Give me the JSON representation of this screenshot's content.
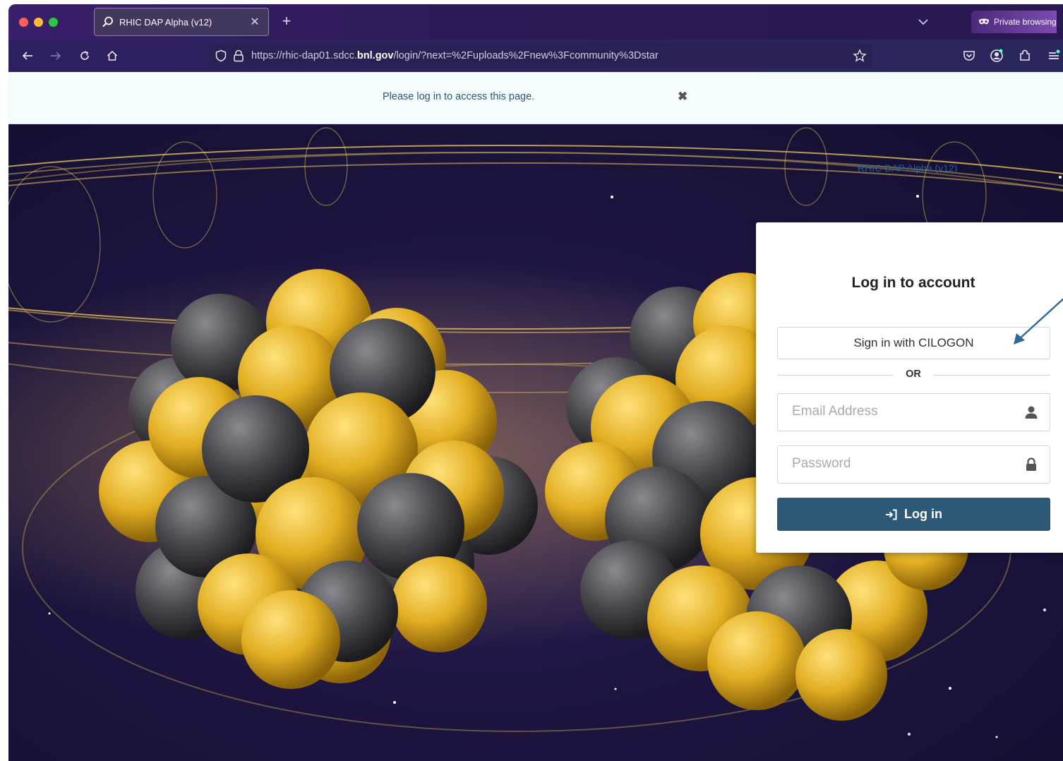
{
  "browser": {
    "tab": {
      "title": "RHIC DAP Alpha (v12)",
      "close_glyph": "✕"
    },
    "new_tab_glyph": "+",
    "private_label": "Private browsing",
    "url": {
      "prefix": "https://rhic-dap01.sdcc.",
      "domain": "bnl.gov",
      "path": "/login/?next=%2Fuploads%2Fnew%3Fcommunity%3Dstar"
    },
    "icons": [
      "back-icon",
      "forward-icon",
      "reload-icon",
      "home-icon",
      "shield-icon",
      "lock-icon",
      "star-icon",
      "pocket-icon",
      "account-icon",
      "extensions-icon",
      "menu-icon"
    ]
  },
  "flash": {
    "message": "Please log in to access this page.",
    "close_glyph": "✖"
  },
  "hero": {
    "watermark": "RHIC DAP Alpha (v12)"
  },
  "login": {
    "title": "Log in to account",
    "cilogon_label": "Sign in with CILOGON",
    "or_label": "OR",
    "email_placeholder": "Email Address",
    "password_placeholder": "Password",
    "submit_label": "Log in"
  },
  "colors": {
    "primary_button": "#2e5a78",
    "flash_text": "#2d5a6f",
    "nucleon_gold": "#e8b62a",
    "nucleon_gray": "#4a4a4e",
    "hero_bg": "#1d1540"
  }
}
